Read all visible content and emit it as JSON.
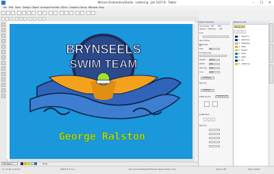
{
  "window": {
    "title": "Wilcom EmbroideryStudio - Lettering - Jak 1027-8   -   Table)"
  },
  "menubar": {
    "items": [
      "File",
      "Edit",
      "View",
      "Design",
      "Object",
      "Arrange",
      "Function",
      "Stitch",
      "Graphics",
      "Setup",
      "Window",
      "Help"
    ]
  },
  "design": {
    "top_text": "BRYNSEELS",
    "banner_text": "SWIM TEAM",
    "name_text": "George Ralston",
    "colors": {
      "background": "#1b97db",
      "navy": "#1c2b57",
      "gold": "#f4a21c",
      "lime": "#a4e030",
      "wave": "#2f64b8"
    }
  },
  "bottombar": {
    "colorway": "Colorway 3",
    "hoop": "Hoop"
  },
  "status": {
    "left": "1x   -21.50,-5.30   0.5",
    "mid": "34878   8.3 mm   ...",
    "center": "Monochrome/Show/HH  Brush/ Sleeve  Flash/ Crop",
    "zoom": "Zoom 1:85",
    "right": "Style Collect"
  },
  "properties": {
    "header": "Object Properties",
    "tabs": [
      "Connectors",
      "Off",
      "Fills"
    ],
    "tabs2": [
      "Special",
      "Lettering",
      "Sati"
    ],
    "labels": [
      "Font",
      "Sprin Mode:",
      "Printer",
      "Size:",
      "TrueType sele",
      "Height:",
      "Width:",
      "Spacing:",
      "Line:",
      "Spacing",
      "Lettering Art:",
      "Justification",
      "Spacing:"
    ],
    "values": {
      "size": "30",
      "height": "14.07",
      "width": "100",
      "spacing": "0.00",
      "line": "0.00"
    },
    "buttons": [
      "Settings...",
      "Settings...",
      "Transform Art"
    ]
  },
  "sequence": {
    "header": "Sequence List",
    "tab": "Design List",
    "rows": [
      {
        "n": "1",
        "name": "Object 1"
      },
      {
        "n": "2",
        "name": "Satinline"
      },
      {
        "n": "3",
        "name": "Satinplus"
      },
      {
        "n": "4",
        "name": "Satin"
      },
      {
        "n": "5",
        "name": "Object"
      },
      {
        "n": "6",
        "name": "Satin"
      },
      {
        "n": "7",
        "name": "Satin"
      },
      {
        "n": "8",
        "name": "Fill"
      },
      {
        "n": "9",
        "name": "Lettering"
      }
    ]
  },
  "vtabs": [
    "Object Properties",
    "Color Palette",
    "Design Library"
  ]
}
